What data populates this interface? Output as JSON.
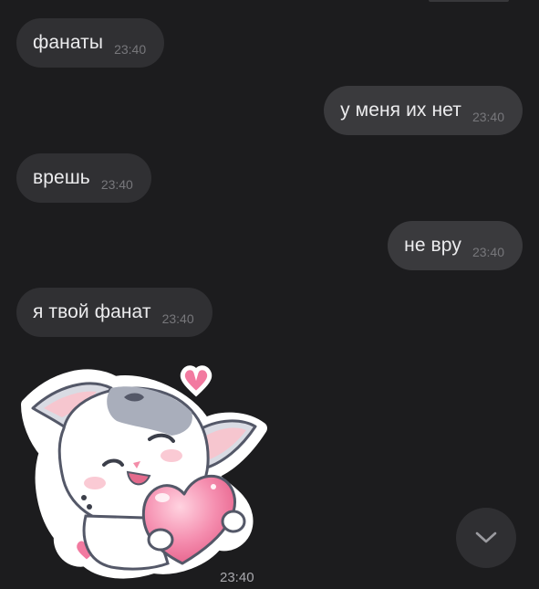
{
  "messages": [
    {
      "direction": "incoming",
      "text": "фанаты",
      "time": "23:40"
    },
    {
      "direction": "outgoing",
      "text": "у меня их нет",
      "time": "23:40"
    },
    {
      "direction": "incoming",
      "text": "врешь",
      "time": "23:40"
    },
    {
      "direction": "outgoing",
      "text": "не вру",
      "time": "23:40"
    },
    {
      "direction": "incoming",
      "text": "я твой фанат",
      "time": "23:40"
    }
  ],
  "sticker": {
    "icon": "cat-holding-heart-sticker",
    "time": "23:40"
  },
  "scroll_button": {
    "icon": "chevron-down-icon"
  },
  "colors": {
    "background": "#1c1c1e",
    "incoming_bubble": "#303033",
    "outgoing_bubble": "#3a3a3d",
    "text": "#ececee",
    "time": "#77777b",
    "heart": "#f27aa0"
  }
}
